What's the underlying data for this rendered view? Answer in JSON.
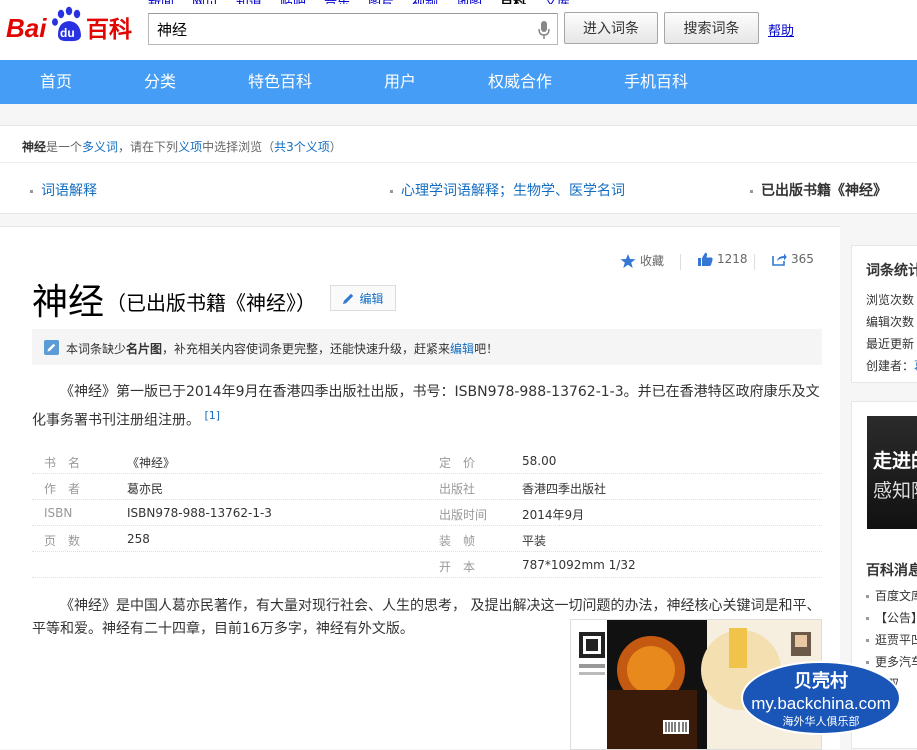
{
  "header": {
    "top_links": [
      "新闻",
      "网页",
      "知道",
      "贴吧",
      "音乐",
      "图片",
      "视频",
      "地图",
      "百科",
      "文库"
    ],
    "top_links_current": 8,
    "logo_text_left": "Bai",
    "logo_text_paw": "du",
    "logo_text_right": "百科",
    "search_value": "神经",
    "enter_button": "进入词条",
    "search_button": "搜索词条",
    "help": "帮助"
  },
  "mainnav": {
    "items": [
      "首页",
      "分类",
      "特色百科",
      "用户",
      "权威合作",
      "手机百科"
    ]
  },
  "disambig": {
    "term": "神经",
    "line_mid": "是一个",
    "polysemy": "多义词",
    "line_mid2": "，请在下列",
    "senses_link": "义项",
    "line_mid3": "中选择浏览（",
    "count_link": "共3个义项",
    "line_end": "）",
    "senses": [
      {
        "label": "词语解释",
        "current": false
      },
      {
        "label": "心理学词语解释；生物学、医学名词",
        "current": false
      },
      {
        "label": "已出版书籍《神经》",
        "current": true
      }
    ]
  },
  "actions": {
    "collect": "收藏",
    "likes": "1218",
    "shares": "365"
  },
  "article": {
    "title": "神经",
    "subtitle": "（已出版书籍《神经》）",
    "edit": "编辑",
    "tip_pre": "本词条缺少",
    "tip_bold": "名片图",
    "tip_mid": "，补充相关内容使词条更完整，还能快速升级，赶紧来",
    "tip_link": "编辑",
    "tip_end": "吧！",
    "para1": "《神经》第一版已于2014年9月在香港四季出版社出版，书号：ISBN978-988-13762-1-3。并已在香港特区政府康乐及文化事务署书刊注册组注册。",
    "para1_ref": "[1]",
    "infobox": [
      {
        "label": "书　名",
        "value": "《神经》",
        "label2": "定　价",
        "value2": "58.00"
      },
      {
        "label": "作　者",
        "value": "葛亦民",
        "label2": "出版社",
        "value2": "香港四季出版社"
      },
      {
        "label": "ISBN",
        "value": "ISBN978-988-13762-1-3",
        "label2": "出版时间",
        "value2": "2014年9月"
      },
      {
        "label": "页　数",
        "value": "258",
        "label2": "装　帧",
        "value2": "平装"
      },
      {
        "label": "",
        "value": "",
        "label2": "开　本",
        "value2": "787*1092mm 1/32"
      }
    ],
    "para2": "《神经》是中国人葛亦民著作，有大量对现行社会、人生的思考， 及提出解决这一切问题的办法，神经核心关键词是和平、平等和爱。神经有二十四章，目前16万多字，神经有外文版。"
  },
  "sidebar": {
    "stats_title": "词条统计",
    "stats": [
      "浏览次数",
      "编辑次数",
      "最近更新",
      "创建者："
    ],
    "creator_link": "葛",
    "ad_line1": "走进的",
    "ad_line2": "感知阿",
    "news_title": "百科消息",
    "news": [
      "百度文库",
      "【公告】",
      "逛贾平凹",
      "更多汽车",
      "港双"
    ]
  },
  "watermark": {
    "line1": "贝壳村",
    "line2": "my.backchina.com",
    "line3": "海外华人俱乐部"
  }
}
